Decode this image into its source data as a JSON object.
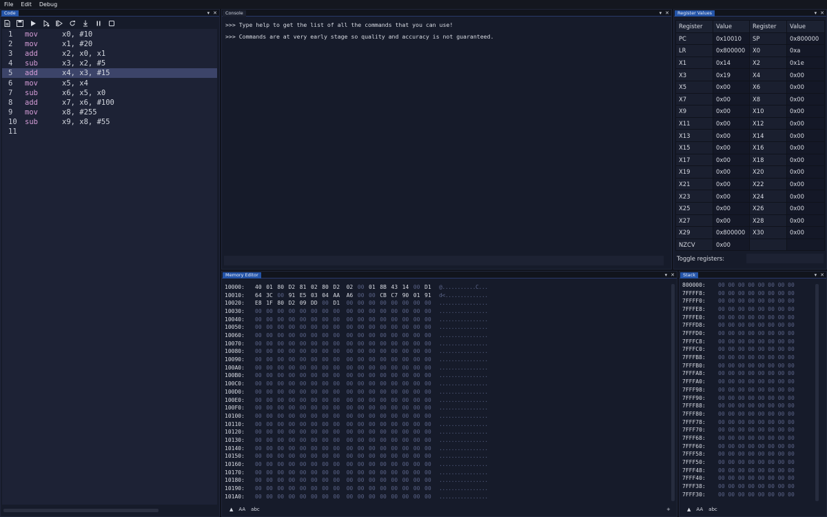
{
  "menu": [
    "File",
    "Edit",
    "Debug"
  ],
  "panels": {
    "code": {
      "title": "Code"
    },
    "console": {
      "title": "Console"
    },
    "registers": {
      "title": "Register Values"
    },
    "memory": {
      "title": "Memory Editor"
    },
    "stack": {
      "title": "Stack"
    }
  },
  "panel_controls": {
    "menu_glyph": "▾",
    "close_glyph": "✕"
  },
  "toolbar_icons": [
    "new-file-icon",
    "save-icon",
    "run-icon",
    "run-step-icon",
    "step-over-icon",
    "restart-icon",
    "step-into-icon",
    "pause-icon",
    "stop-icon"
  ],
  "code": {
    "highlighted_line": 5,
    "lines": [
      {
        "n": "1",
        "op": "mov",
        "args": "x0, #10"
      },
      {
        "n": "2",
        "op": "mov",
        "args": "x1, #20"
      },
      {
        "n": "3",
        "op": "add",
        "args": "x2, x0, x1"
      },
      {
        "n": "4",
        "op": "sub",
        "args": "x3, x2, #5"
      },
      {
        "n": "5",
        "op": "add",
        "args": "x4, x3, #15"
      },
      {
        "n": "6",
        "op": "mov",
        "args": "x5, x4"
      },
      {
        "n": "7",
        "op": "sub",
        "args": "x6, x5, x0"
      },
      {
        "n": "8",
        "op": "add",
        "args": "x7, x6, #100"
      },
      {
        "n": "9",
        "op": "mov",
        "args": "x8, #255"
      },
      {
        "n": "10",
        "op": "sub",
        "args": "x9, x8, #55"
      },
      {
        "n": "11",
        "op": "",
        "args": ""
      }
    ]
  },
  "console": {
    "lines": [
      ">>> Type help to get the list of all the commands that you can use!",
      ">>> Commands are at very early stage so quality and accuracy is not guaranteed."
    ],
    "input_value": ""
  },
  "registers": {
    "headers": [
      "Register",
      "Value",
      "Register",
      "Value"
    ],
    "rows": [
      [
        "PC",
        "0x10010",
        "SP",
        "0x800000"
      ],
      [
        "LR",
        "0x800000",
        "X0",
        "0xa"
      ],
      [
        "X1",
        "0x14",
        "X2",
        "0x1e"
      ],
      [
        "X3",
        "0x19",
        "X4",
        "0x00"
      ],
      [
        "X5",
        "0x00",
        "X6",
        "0x00"
      ],
      [
        "X7",
        "0x00",
        "X8",
        "0x00"
      ],
      [
        "X9",
        "0x00",
        "X10",
        "0x00"
      ],
      [
        "X11",
        "0x00",
        "X12",
        "0x00"
      ],
      [
        "X13",
        "0x00",
        "X14",
        "0x00"
      ],
      [
        "X15",
        "0x00",
        "X16",
        "0x00"
      ],
      [
        "X17",
        "0x00",
        "X18",
        "0x00"
      ],
      [
        "X19",
        "0x00",
        "X20",
        "0x00"
      ],
      [
        "X21",
        "0x00",
        "X22",
        "0x00"
      ],
      [
        "X23",
        "0x00",
        "X24",
        "0x00"
      ],
      [
        "X25",
        "0x00",
        "X26",
        "0x00"
      ],
      [
        "X27",
        "0x00",
        "X28",
        "0x00"
      ],
      [
        "X29",
        "0x800000",
        "X30",
        "0x00"
      ],
      [
        "NZCV",
        "0x00",
        "",
        ""
      ]
    ],
    "toggle_label": "Toggle registers:",
    "toggle_value": ""
  },
  "memory": {
    "rows": [
      {
        "addr": "10000:",
        "bytes": [
          "40",
          "01",
          "80",
          "D2",
          "81",
          "02",
          "80",
          "D2",
          "02",
          "00",
          "01",
          "8B",
          "43",
          "14",
          "00",
          "D1"
        ],
        "ascii": "@...........C..."
      },
      {
        "addr": "10010:",
        "bytes": [
          "64",
          "3C",
          "00",
          "91",
          "E5",
          "03",
          "04",
          "AA",
          "A6",
          "00",
          "00",
          "CB",
          "C7",
          "90",
          "01",
          "91"
        ],
        "ascii": "d<.............."
      },
      {
        "addr": "10020:",
        "bytes": [
          "E8",
          "1F",
          "80",
          "D2",
          "09",
          "DD",
          "00",
          "D1",
          "00",
          "00",
          "00",
          "00",
          "00",
          "00",
          "00",
          "00"
        ],
        "ascii": "................"
      },
      {
        "addr": "10030:",
        "bytes": [
          "00",
          "00",
          "00",
          "00",
          "00",
          "00",
          "00",
          "00",
          "00",
          "00",
          "00",
          "00",
          "00",
          "00",
          "00",
          "00"
        ],
        "ascii": "................"
      },
      {
        "addr": "10040:",
        "bytes": [
          "00",
          "00",
          "00",
          "00",
          "00",
          "00",
          "00",
          "00",
          "00",
          "00",
          "00",
          "00",
          "00",
          "00",
          "00",
          "00"
        ],
        "ascii": "................"
      },
      {
        "addr": "10050:",
        "bytes": [
          "00",
          "00",
          "00",
          "00",
          "00",
          "00",
          "00",
          "00",
          "00",
          "00",
          "00",
          "00",
          "00",
          "00",
          "00",
          "00"
        ],
        "ascii": "................"
      },
      {
        "addr": "10060:",
        "bytes": [
          "00",
          "00",
          "00",
          "00",
          "00",
          "00",
          "00",
          "00",
          "00",
          "00",
          "00",
          "00",
          "00",
          "00",
          "00",
          "00"
        ],
        "ascii": "................"
      },
      {
        "addr": "10070:",
        "bytes": [
          "00",
          "00",
          "00",
          "00",
          "00",
          "00",
          "00",
          "00",
          "00",
          "00",
          "00",
          "00",
          "00",
          "00",
          "00",
          "00"
        ],
        "ascii": "................"
      },
      {
        "addr": "10080:",
        "bytes": [
          "00",
          "00",
          "00",
          "00",
          "00",
          "00",
          "00",
          "00",
          "00",
          "00",
          "00",
          "00",
          "00",
          "00",
          "00",
          "00"
        ],
        "ascii": "................"
      },
      {
        "addr": "10090:",
        "bytes": [
          "00",
          "00",
          "00",
          "00",
          "00",
          "00",
          "00",
          "00",
          "00",
          "00",
          "00",
          "00",
          "00",
          "00",
          "00",
          "00"
        ],
        "ascii": "................"
      },
      {
        "addr": "100A0:",
        "bytes": [
          "00",
          "00",
          "00",
          "00",
          "00",
          "00",
          "00",
          "00",
          "00",
          "00",
          "00",
          "00",
          "00",
          "00",
          "00",
          "00"
        ],
        "ascii": "................"
      },
      {
        "addr": "100B0:",
        "bytes": [
          "00",
          "00",
          "00",
          "00",
          "00",
          "00",
          "00",
          "00",
          "00",
          "00",
          "00",
          "00",
          "00",
          "00",
          "00",
          "00"
        ],
        "ascii": "................"
      },
      {
        "addr": "100C0:",
        "bytes": [
          "00",
          "00",
          "00",
          "00",
          "00",
          "00",
          "00",
          "00",
          "00",
          "00",
          "00",
          "00",
          "00",
          "00",
          "00",
          "00"
        ],
        "ascii": "................"
      },
      {
        "addr": "100D0:",
        "bytes": [
          "00",
          "00",
          "00",
          "00",
          "00",
          "00",
          "00",
          "00",
          "00",
          "00",
          "00",
          "00",
          "00",
          "00",
          "00",
          "00"
        ],
        "ascii": "................"
      },
      {
        "addr": "100E0:",
        "bytes": [
          "00",
          "00",
          "00",
          "00",
          "00",
          "00",
          "00",
          "00",
          "00",
          "00",
          "00",
          "00",
          "00",
          "00",
          "00",
          "00"
        ],
        "ascii": "................"
      },
      {
        "addr": "100F0:",
        "bytes": [
          "00",
          "00",
          "00",
          "00",
          "00",
          "00",
          "00",
          "00",
          "00",
          "00",
          "00",
          "00",
          "00",
          "00",
          "00",
          "00"
        ],
        "ascii": "................"
      },
      {
        "addr": "10100:",
        "bytes": [
          "00",
          "00",
          "00",
          "00",
          "00",
          "00",
          "00",
          "00",
          "00",
          "00",
          "00",
          "00",
          "00",
          "00",
          "00",
          "00"
        ],
        "ascii": "................"
      },
      {
        "addr": "10110:",
        "bytes": [
          "00",
          "00",
          "00",
          "00",
          "00",
          "00",
          "00",
          "00",
          "00",
          "00",
          "00",
          "00",
          "00",
          "00",
          "00",
          "00"
        ],
        "ascii": "................"
      },
      {
        "addr": "10120:",
        "bytes": [
          "00",
          "00",
          "00",
          "00",
          "00",
          "00",
          "00",
          "00",
          "00",
          "00",
          "00",
          "00",
          "00",
          "00",
          "00",
          "00"
        ],
        "ascii": "................"
      },
      {
        "addr": "10130:",
        "bytes": [
          "00",
          "00",
          "00",
          "00",
          "00",
          "00",
          "00",
          "00",
          "00",
          "00",
          "00",
          "00",
          "00",
          "00",
          "00",
          "00"
        ],
        "ascii": "................"
      },
      {
        "addr": "10140:",
        "bytes": [
          "00",
          "00",
          "00",
          "00",
          "00",
          "00",
          "00",
          "00",
          "00",
          "00",
          "00",
          "00",
          "00",
          "00",
          "00",
          "00"
        ],
        "ascii": "................"
      },
      {
        "addr": "10150:",
        "bytes": [
          "00",
          "00",
          "00",
          "00",
          "00",
          "00",
          "00",
          "00",
          "00",
          "00",
          "00",
          "00",
          "00",
          "00",
          "00",
          "00"
        ],
        "ascii": "................"
      },
      {
        "addr": "10160:",
        "bytes": [
          "00",
          "00",
          "00",
          "00",
          "00",
          "00",
          "00",
          "00",
          "00",
          "00",
          "00",
          "00",
          "00",
          "00",
          "00",
          "00"
        ],
        "ascii": "................"
      },
      {
        "addr": "10170:",
        "bytes": [
          "00",
          "00",
          "00",
          "00",
          "00",
          "00",
          "00",
          "00",
          "00",
          "00",
          "00",
          "00",
          "00",
          "00",
          "00",
          "00"
        ],
        "ascii": "................"
      },
      {
        "addr": "10180:",
        "bytes": [
          "00",
          "00",
          "00",
          "00",
          "00",
          "00",
          "00",
          "00",
          "00",
          "00",
          "00",
          "00",
          "00",
          "00",
          "00",
          "00"
        ],
        "ascii": "................"
      },
      {
        "addr": "10190:",
        "bytes": [
          "00",
          "00",
          "00",
          "00",
          "00",
          "00",
          "00",
          "00",
          "00",
          "00",
          "00",
          "00",
          "00",
          "00",
          "00",
          "00"
        ],
        "ascii": "................"
      },
      {
        "addr": "101A0:",
        "bytes": [
          "00",
          "00",
          "00",
          "00",
          "00",
          "00",
          "00",
          "00",
          "00",
          "00",
          "00",
          "00",
          "00",
          "00",
          "00",
          "00"
        ],
        "ascii": "................"
      }
    ],
    "footer": {
      "up_glyph": "▲",
      "case_label": "AA",
      "text_label": "abc",
      "add_glyph": "+"
    }
  },
  "stack": {
    "rows": [
      {
        "addr": "800000:",
        "hex": "00 00 00 00 00 00 00 00"
      },
      {
        "addr": "7FFFF8:",
        "hex": "00 00 00 00 00 00 00 00"
      },
      {
        "addr": "7FFFF0:",
        "hex": "00 00 00 00 00 00 00 00"
      },
      {
        "addr": "7FFFE8:",
        "hex": "00 00 00 00 00 00 00 00"
      },
      {
        "addr": "7FFFE0:",
        "hex": "00 00 00 00 00 00 00 00"
      },
      {
        "addr": "7FFFD8:",
        "hex": "00 00 00 00 00 00 00 00"
      },
      {
        "addr": "7FFFD0:",
        "hex": "00 00 00 00 00 00 00 00"
      },
      {
        "addr": "7FFFC8:",
        "hex": "00 00 00 00 00 00 00 00"
      },
      {
        "addr": "7FFFC0:",
        "hex": "00 00 00 00 00 00 00 00"
      },
      {
        "addr": "7FFFB8:",
        "hex": "00 00 00 00 00 00 00 00"
      },
      {
        "addr": "7FFFB0:",
        "hex": "00 00 00 00 00 00 00 00"
      },
      {
        "addr": "7FFFA8:",
        "hex": "00 00 00 00 00 00 00 00"
      },
      {
        "addr": "7FFFA0:",
        "hex": "00 00 00 00 00 00 00 00"
      },
      {
        "addr": "7FFF98:",
        "hex": "00 00 00 00 00 00 00 00"
      },
      {
        "addr": "7FFF90:",
        "hex": "00 00 00 00 00 00 00 00"
      },
      {
        "addr": "7FFF88:",
        "hex": "00 00 00 00 00 00 00 00"
      },
      {
        "addr": "7FFF80:",
        "hex": "00 00 00 00 00 00 00 00"
      },
      {
        "addr": "7FFF78:",
        "hex": "00 00 00 00 00 00 00 00"
      },
      {
        "addr": "7FFF70:",
        "hex": "00 00 00 00 00 00 00 00"
      },
      {
        "addr": "7FFF68:",
        "hex": "00 00 00 00 00 00 00 00"
      },
      {
        "addr": "7FFF60:",
        "hex": "00 00 00 00 00 00 00 00"
      },
      {
        "addr": "7FFF58:",
        "hex": "00 00 00 00 00 00 00 00"
      },
      {
        "addr": "7FFF50:",
        "hex": "00 00 00 00 00 00 00 00"
      },
      {
        "addr": "7FFF48:",
        "hex": "00 00 00 00 00 00 00 00"
      },
      {
        "addr": "7FFF40:",
        "hex": "00 00 00 00 00 00 00 00"
      },
      {
        "addr": "7FFF38:",
        "hex": "00 00 00 00 00 00 00 00"
      },
      {
        "addr": "7FFF30:",
        "hex": "00 00 00 00 00 00 00 00"
      }
    ],
    "footer": {
      "up_glyph": "▲",
      "case_label": "AA",
      "text_label": "abc"
    }
  },
  "colors": {
    "accent": "#2454a8",
    "highlight": "#3c4469",
    "opcode": "#d39bd6",
    "zero_byte": "#5a6387"
  }
}
